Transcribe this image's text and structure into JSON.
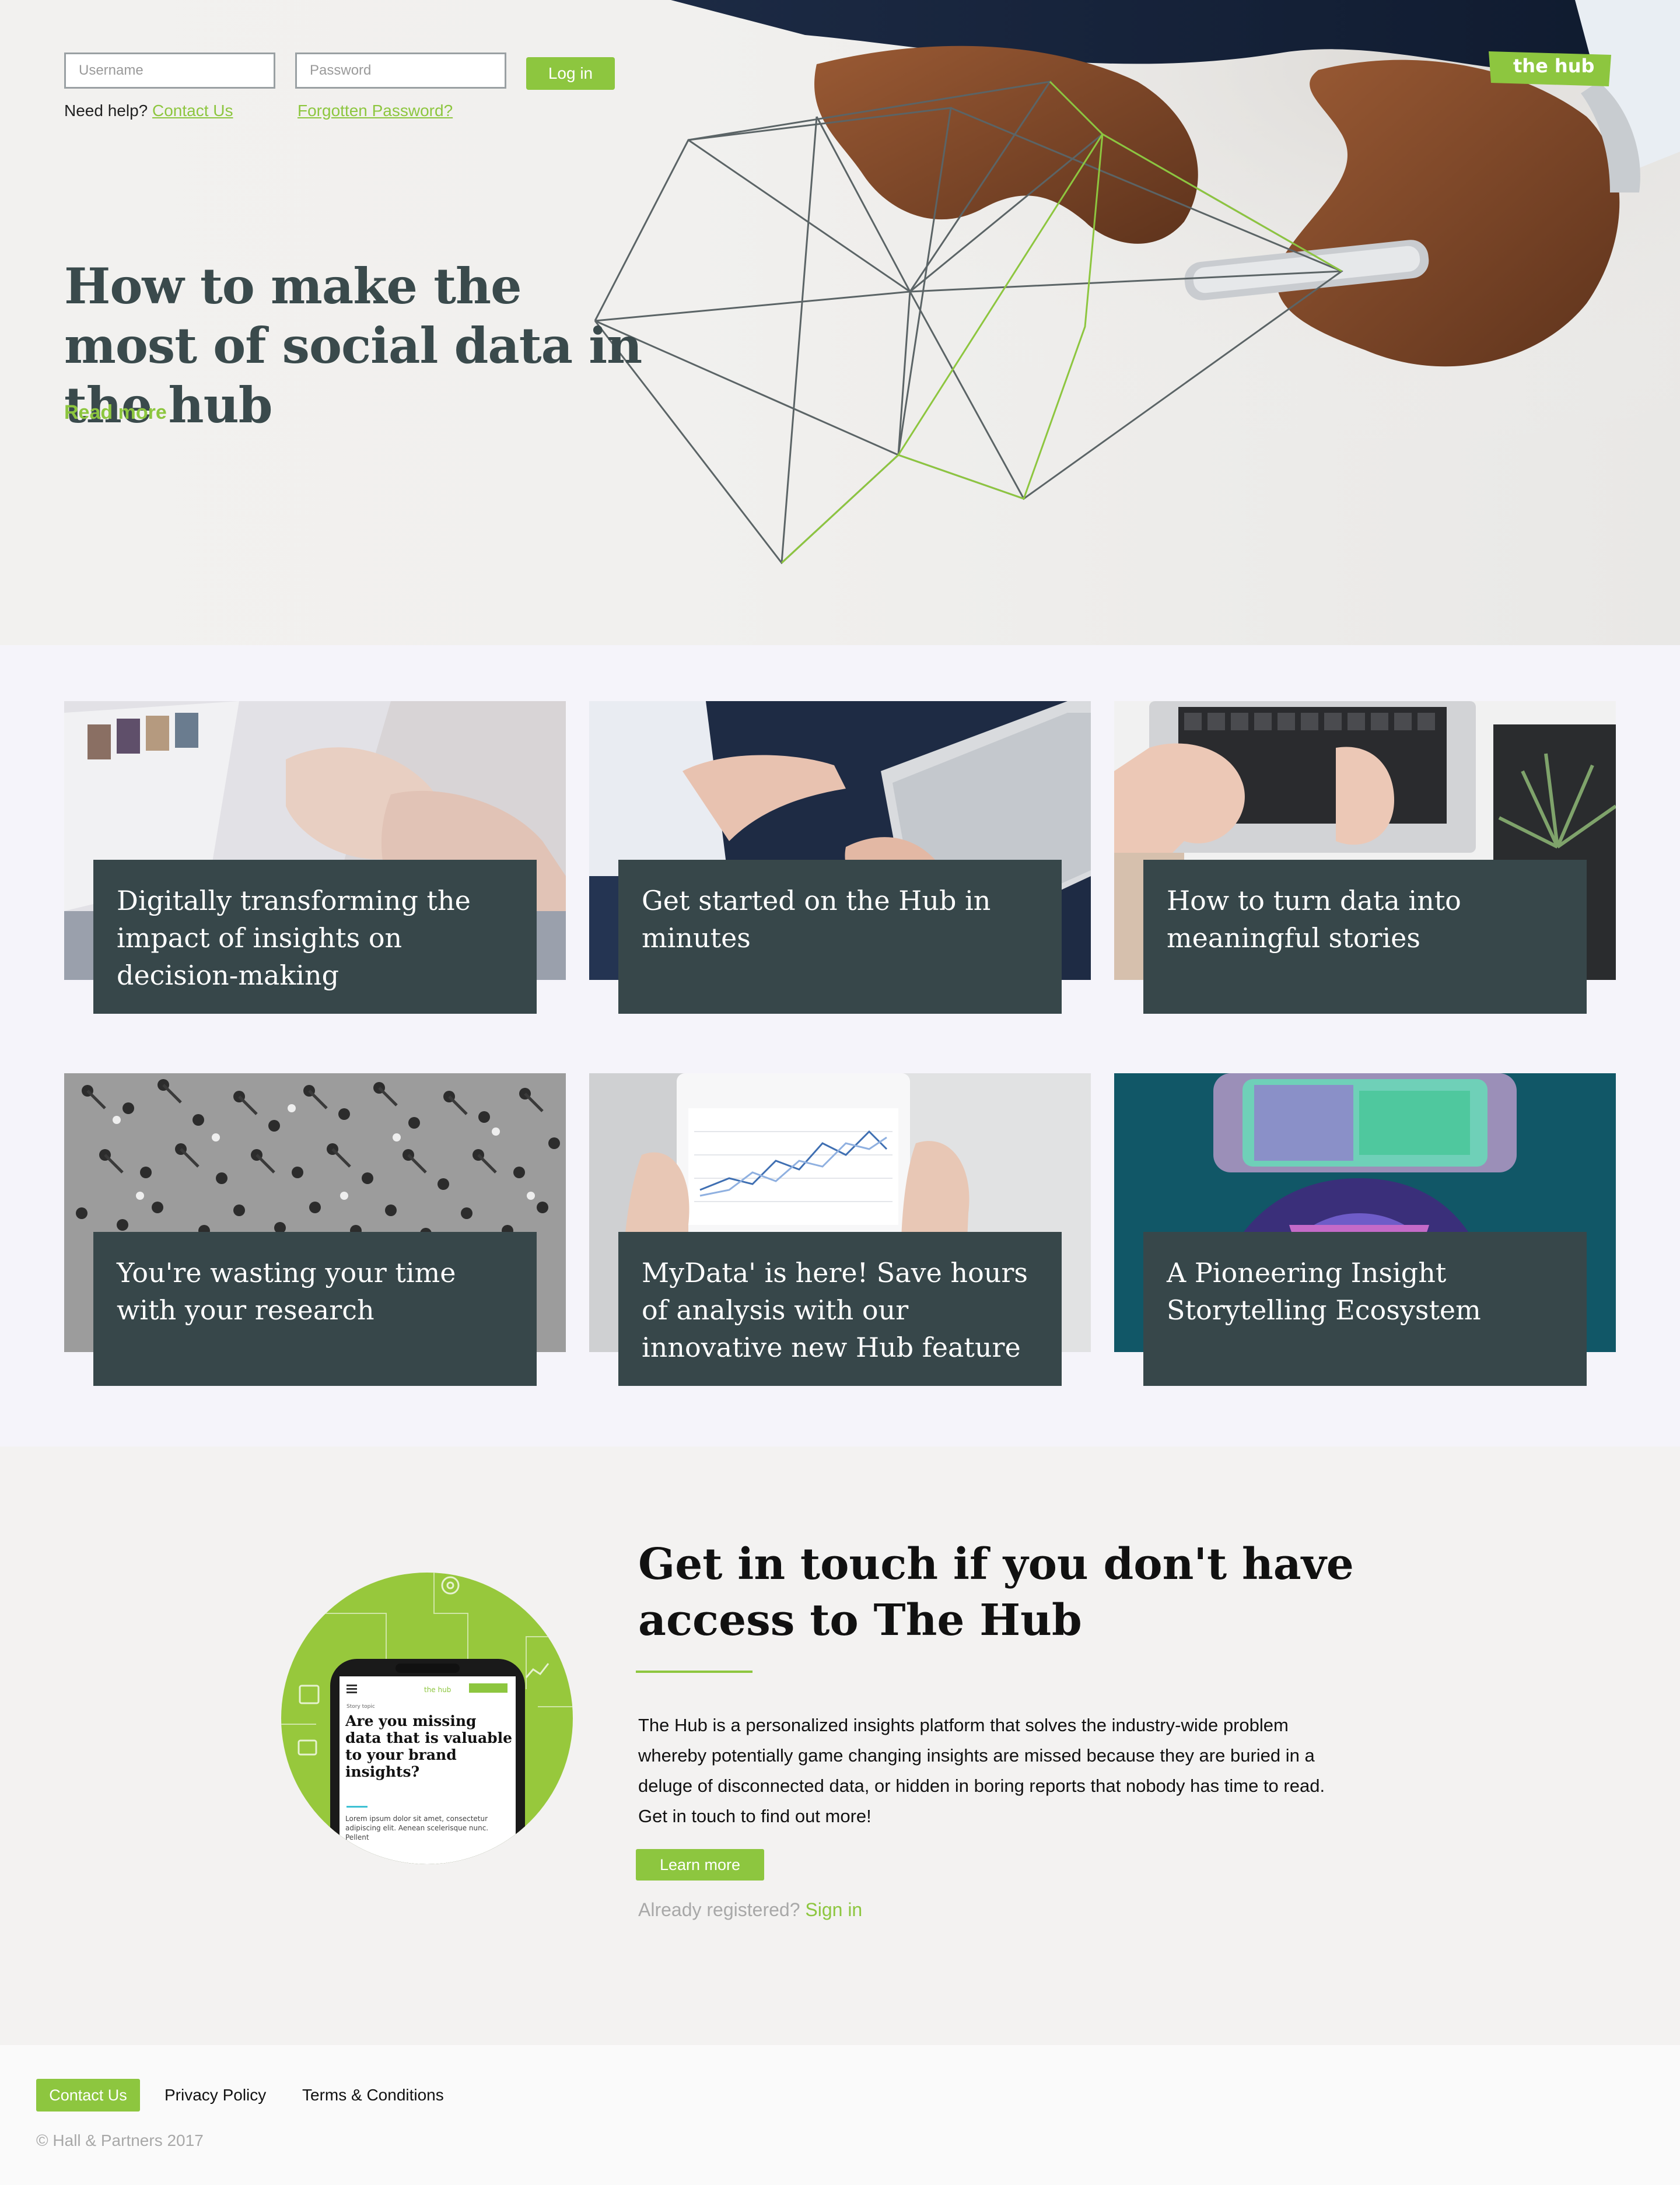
{
  "login": {
    "username_placeholder": "Username",
    "password_placeholder": "Password",
    "login_label": "Log in",
    "help_text": "Need help?",
    "contact_link": "Contact Us",
    "forgot_link": "Forgotten Password?"
  },
  "brand": {
    "logo_text": "the hub",
    "accent": "#8dc63f",
    "dark_panel": "#37474a"
  },
  "hero": {
    "title": "How to make the most of social data in the hub",
    "read_more": "Read more"
  },
  "cards": [
    {
      "title": "Digitally transforming the impact of insights on decision-making",
      "image": "laptop-typing-photo"
    },
    {
      "title": "Get started on the Hub in minutes",
      "image": "tablet-pointing-photo"
    },
    {
      "title": "How to turn data into meaningful stories",
      "image": "keyboard-plant-photo"
    },
    {
      "title": "You're wasting your time with your research",
      "image": "crowd-aerial-photo"
    },
    {
      "title": "MyData' is here! Save hours of analysis with our innovative new Hub feature",
      "image": "tablet-chart-photo"
    },
    {
      "title": "A Pioneering Insight Storytelling Ecosystem",
      "image": "vr-headset-photo"
    }
  ],
  "access": {
    "title": "Get in touch if you don't have access to The Hub",
    "body": "The Hub is a personalized insights platform that solves the industry-wide problem whereby potentially game changing insights are missed because they are buried in a deluge of disconnected data, or hidden in boring reports that nobody has time to read. Get in touch to find out more!",
    "learn_more": "Learn more",
    "already_registered": "Already registered?",
    "sign_in": "Sign in",
    "phone": {
      "logo": "the hub",
      "tag": "Story topic",
      "headline": "Are you missing data that is valuable to your brand insights?",
      "lorem": "Lorem ipsum dolor sit amet, consectetur adipiscing elit. Aenean scelerisque nunc. Pellent"
    }
  },
  "footer": {
    "contact": "Contact Us",
    "privacy": "Privacy Policy",
    "terms": "Terms & Conditions",
    "copyright": "© Hall & Partners 2017"
  }
}
